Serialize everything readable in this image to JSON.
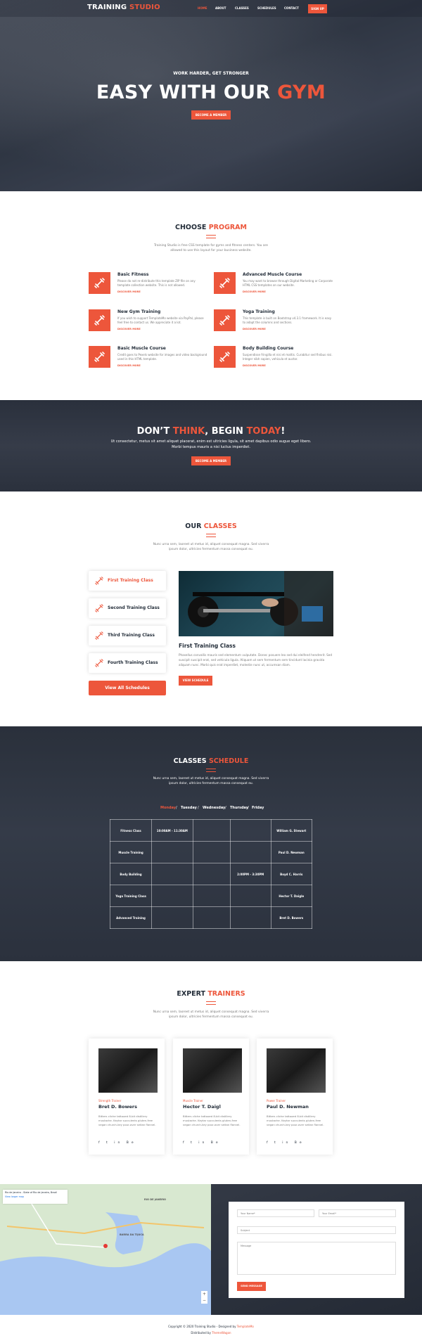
{
  "colors": {
    "accent": "#ed563b",
    "dark": "#232d39",
    "text": "#7a7a7a"
  },
  "nav": {
    "logo_a": "TRAINING",
    "logo_b": "STUDIO",
    "items": [
      "HOME",
      "ABOUT",
      "CLASSES",
      "SCHEDULES",
      "CONTACT"
    ],
    "signup": "SIGN UP"
  },
  "hero": {
    "subtitle": "WORK HARDER, GET STRONGER",
    "title_a": "EASY WITH OUR",
    "title_b": "GYM",
    "button": "BECOME A MEMBER"
  },
  "programs": {
    "heading_a": "CHOOSE",
    "heading_b": "PROGRAM",
    "intro": "Training Studio is free CSS template for gyms and fitness centers. You are allowed to use this layout for your business website.",
    "items": [
      {
        "icon": "dumbbell-icon",
        "title": "Basic Fitness",
        "desc": "Please do not re-distribute this template ZIP file on any template collection website. This is not allowed.",
        "link": "DISCOVER MORE"
      },
      {
        "icon": "dumbbell-icon",
        "title": "Advanced Muscle Course",
        "desc": "You may want to browse through Digital Marketing or Corporate HTML CSS templates on our website.",
        "link": "DISCOVER MORE"
      },
      {
        "icon": "dumbbell-icon",
        "title": "New Gym Training",
        "desc": "If you wish to support TemplateMo website via PayPal, please feel free to contact us. We appreciate it a lot.",
        "link": "DISCOVER MORE"
      },
      {
        "icon": "dumbbell-icon",
        "title": "Yoga Training",
        "desc": "This template is built on Bootstrap v4.3.1 framework. It is easy to adapt the columns and sections.",
        "link": "DISCOVER MORE"
      },
      {
        "icon": "dumbbell-icon",
        "title": "Basic Muscle Course",
        "desc": "Credit goes to Pexels website for images and video background used in this HTML template.",
        "link": "DISCOVER MORE"
      },
      {
        "icon": "dumbbell-icon",
        "title": "Body Building Course",
        "desc": "Suspendisse fringilla et nisi et mattis. Curabitur sed finibus nisi. Integer nibh sapien, vehicula et auctor.",
        "link": "DISCOVER MORE"
      }
    ]
  },
  "cta": {
    "t1": "DON’T ",
    "t2": "THINK",
    "t3": ", BEGIN ",
    "t4": "TODAY",
    "t5": "!",
    "text": "Ut consectetur, metus sit amet aliquet placerat, enim est ultricies ligula, sit amet dapibus odio augue eget libero. Morbi tempus mauris a nisi luctus imperdiet.",
    "button": "BECOME A MEMBER"
  },
  "classes": {
    "heading_a": "OUR",
    "heading_b": "CLASSES",
    "intro": "Nunc urna sem, laoreet ut metus id, aliquet consequat magna. Sed viverra ipsum dolor, ultricies fermentum massa consequat eu.",
    "tabs": [
      "First Training Class",
      "Second Training Class",
      "Third Training Class",
      "Fourth Training Class"
    ],
    "all_button": "View All Schedules",
    "detail_title": "First Training Class",
    "detail_text": "Phasellus convallis mauris sed elementum vulputate. Donec posuere leo sed dui eleifend hendrerit. Sed suscipit suscipit erat, sed vehicula ligula. Aliquam ut sem fermentum sem tincidunt lacinia gravida aliquam nunc. Morbi quis erat imperdiet, molestie nunc ut, accumsan diam.",
    "detail_button": "VIEW SCHEDULE"
  },
  "schedule": {
    "heading_a": "CLASSES",
    "heading_b": "SCHEDULE",
    "intro": "Nunc urna sem, laoreet ut metus id, aliquet consequat magna. Sed viverra ipsum dolor, ultricies fermentum massa consequat eu.",
    "days": [
      "Monday",
      "Tuesday",
      "Wednesday",
      "Thursday",
      "Friday"
    ],
    "rows": [
      [
        "Fitness Class",
        "10:00AM - 11:30AM",
        "",
        "",
        "William G. Stewart"
      ],
      [
        "Muscle Training",
        "",
        "",
        "",
        "Paul D. Newman"
      ],
      [
        "Body Building",
        "",
        "",
        "2:00PM - 3:30PM",
        "Boyd C. Harris"
      ],
      [
        "Yoga Training Class",
        "",
        "",
        "",
        "Hector T. Daigle"
      ],
      [
        "Advanced Training",
        "",
        "",
        "",
        "Bret D. Bowers"
      ]
    ]
  },
  "trainers": {
    "heading_a": "EXPERT",
    "heading_b": "TRAINERS",
    "intro": "Nunc urna sem, laoreet ut metus id, aliquet consequat magna. Sed viverra ipsum dolor, ultricies fermentum massa consequat eu.",
    "items": [
      {
        "role": "Strength Trainer",
        "name": "Bret D. Bowers",
        "desc": "Bitters cliche tattooed 8-bit distillery mustache. Keytar succulents gluten-free vegan church-key pour-over seitan flannel."
      },
      {
        "role": "Muscle Trainer",
        "name": "Hector T. Daigl",
        "desc": "Bitters cliche tattooed 8-bit distillery mustache. Keytar succulents gluten-free vegan church-key pour-over seitan flannel."
      },
      {
        "role": "Power Trainer",
        "name": "Paul D. Newman",
        "desc": "Bitters cliche tattooed 8-bit distillery mustache. Keytar succulents gluten-free vegan church-key pour-over seitan flannel."
      }
    ],
    "social": "f  t  in  Be"
  },
  "contact": {
    "map_place": "Rio de Janeiro - State of Rio de Janeiro, Brazil",
    "map_link": "View larger map",
    "map_labels": [
      "BARRA DA TIJUCA",
      "RIO DE JANEIRO"
    ],
    "name_ph": "Your Name*",
    "email_ph": "Your Email*",
    "subject_ph": "Subject",
    "message_ph": "Message",
    "send": "SEND MESSAGE"
  },
  "footer": {
    "line1_a": "Copyright © 2020 Training Studio - Designed by ",
    "line1_b": "TemplateMo",
    "line2_a": "Distributed by ",
    "line2_b": "ThemeWagon"
  }
}
